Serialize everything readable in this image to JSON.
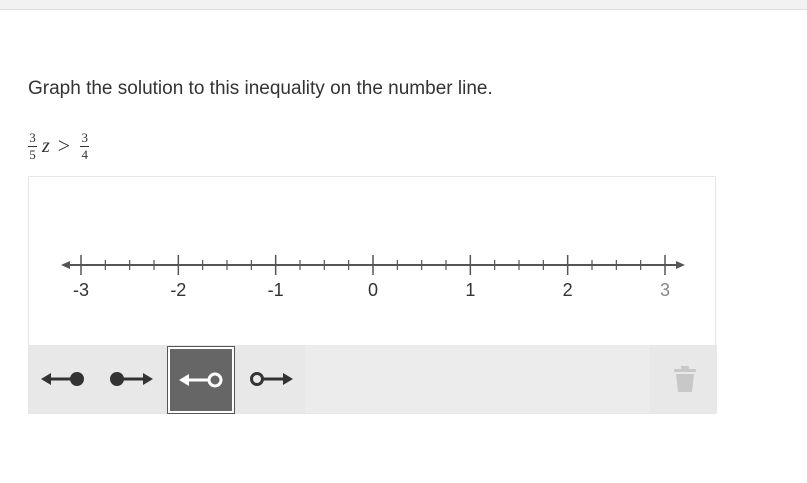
{
  "question": {
    "prompt": "Graph the solution to this inequality on the number line.",
    "equation": {
      "coef_num": "3",
      "coef_den": "5",
      "variable": "z",
      "operator": ">",
      "rhs_num": "3",
      "rhs_den": "4"
    }
  },
  "number_line": {
    "min": -3,
    "max": 3,
    "minor_step": 0.25,
    "labels": [
      "-3",
      "-2",
      "-1",
      "0",
      "1",
      "2",
      "3"
    ],
    "label_color": "#333333",
    "last_label_color": "#888888",
    "axis_color": "#555555"
  },
  "toolbar": {
    "tools": [
      {
        "name": "closed-left-ray-tool",
        "icon": "arrow-left-closed-dot-icon",
        "selected": false
      },
      {
        "name": "closed-right-ray-tool",
        "icon": "arrow-right-closed-dot-icon",
        "selected": false
      },
      {
        "name": "open-left-ray-tool",
        "icon": "arrow-left-open-dot-icon",
        "selected": true
      },
      {
        "name": "open-right-ray-tool",
        "icon": "arrow-right-open-dot-icon",
        "selected": false
      }
    ],
    "delete_icon": "trash-icon",
    "selected_color": "#666666",
    "toolbar_bg": "#e8e8e8"
  }
}
